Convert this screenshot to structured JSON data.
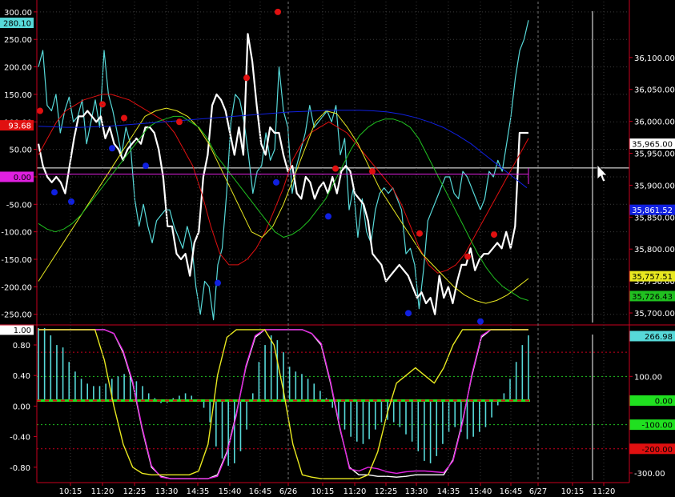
{
  "colors": {
    "background": "#000000",
    "axis": "#c8001e",
    "grid": "#3a3a3a",
    "tick_text": "#ffffff",
    "cyan": "#57d9d9",
    "white": "#ffffff",
    "red": "#e01010",
    "yellow": "#e8e820",
    "green": "#20c020",
    "blue": "#1020e0",
    "magenta": "#e020e0"
  },
  "chart_data": [
    {
      "type": "line",
      "title": "",
      "x_ticks": [
        "10:15",
        "11:20",
        "12:25",
        "13:30",
        "14:35",
        "15:40",
        "16:45",
        "6/26",
        "10:15",
        "11:20",
        "12:25",
        "13:30",
        "14:35",
        "15:40",
        "16:45",
        "6/27",
        "10:15",
        "11:20"
      ],
      "left_axis": {
        "ticks": [
          300,
          250,
          200,
          150,
          100,
          50,
          0,
          -50,
          -100,
          -150,
          -200,
          -250
        ],
        "ylim": [
          -265,
          310
        ]
      },
      "right_axis": {
        "ticks": [
          36100,
          36050,
          36000,
          35950,
          35900,
          35850,
          35800,
          35750,
          35700
        ],
        "ylim": [
          35685,
          36180
        ]
      },
      "value_labels": [
        {
          "text": "280.10",
          "bg": "#57d9d9",
          "fg": "#000000",
          "side": "left",
          "y_value": 280.1
        },
        {
          "text": "93.68",
          "bg": "#e01010",
          "fg": "#ffffff",
          "side": "left",
          "y_value": 93.68
        },
        {
          "text": "0.00",
          "bg": "#e020e0",
          "fg": "#000000",
          "side": "left",
          "y_value": 0
        },
        {
          "text": "35,965.00",
          "bg": "#ffffff",
          "fg": "#000000",
          "side": "right",
          "y_value": 35965
        },
        {
          "text": "35,861.52",
          "bg": "#1020e0",
          "fg": "#ffffff",
          "side": "right",
          "y_value": 35861.52
        },
        {
          "text": "35,757.51",
          "bg": "#e8e820",
          "fg": "#000000",
          "side": "right",
          "y_value": 35757.51
        },
        {
          "text": "35,726.43",
          "bg": "#20c020",
          "fg": "#000000",
          "side": "right",
          "y_value": 35726.43
        }
      ],
      "hline_value": 35927,
      "series": [
        {
          "color": "#57d9d9",
          "axis": "left",
          "y": [
            200,
            230,
            130,
            120,
            150,
            80,
            120,
            145,
            100,
            110,
            140,
            60,
            100,
            140,
            90,
            230,
            150,
            120,
            80,
            40,
            90,
            60,
            -40,
            -90,
            -50,
            -90,
            -120,
            -80,
            -70,
            -60,
            -60,
            -90,
            -110,
            -130,
            -90,
            -120,
            -200,
            -250,
            -190,
            -200,
            -260,
            -160,
            -130,
            -30,
            100,
            150,
            140,
            100,
            40,
            -30,
            10,
            20,
            80,
            30,
            50,
            200,
            120,
            90,
            -30,
            20,
            50,
            80,
            130,
            90,
            100,
            110,
            120,
            100,
            130,
            40,
            70,
            -60,
            -20,
            -110,
            -40,
            -100,
            -120,
            -60,
            -30,
            -20,
            -30,
            -20,
            -40,
            -60,
            -140,
            -130,
            -160,
            -240,
            -170,
            -80,
            -60,
            -40,
            -20,
            0,
            0,
            -30,
            -40,
            10,
            0,
            -20,
            -40,
            -60,
            -40,
            10,
            0,
            30,
            10,
            60,
            110,
            180,
            230,
            250,
            285
          ]
        },
        {
          "color": "#ffffff",
          "axis": "left",
          "y": [
            60,
            20,
            0,
            -10,
            0,
            -10,
            -30,
            20,
            70,
            110,
            110,
            120,
            110,
            100,
            110,
            70,
            90,
            60,
            50,
            30,
            50,
            60,
            70,
            60,
            90,
            90,
            80,
            50,
            0,
            -90,
            -90,
            -140,
            -150,
            -140,
            -180,
            -120,
            -100,
            0,
            40,
            130,
            150,
            140,
            120,
            80,
            40,
            90,
            40,
            260,
            210,
            130,
            60,
            40,
            90,
            80,
            80,
            40,
            10,
            20,
            -30,
            -40,
            0,
            -10,
            -40,
            -20,
            -10,
            -30,
            0,
            -30,
            10,
            20,
            10,
            -30,
            -40,
            -50,
            -80,
            -140,
            -150,
            -160,
            -190,
            -180,
            -170,
            -160,
            -170,
            -180,
            -200,
            -220,
            -210,
            -230,
            -220,
            -250,
            -180,
            -220,
            -200,
            -230,
            -190,
            -160,
            -160,
            -130,
            -170,
            -150,
            -140,
            -140,
            -130,
            -120,
            -130,
            -100,
            -130,
            -90,
            80,
            80,
            80
          ]
        },
        {
          "color": "#e01010",
          "axis": "left",
          "y": [
            40,
            70,
            100,
            120,
            130,
            140,
            145,
            150,
            150,
            145,
            140,
            130,
            120,
            110,
            100,
            80,
            50,
            20,
            -30,
            -90,
            -140,
            -160,
            -160,
            -150,
            -130,
            -100,
            -60,
            -20,
            30,
            60,
            80,
            90,
            100,
            90,
            80,
            60,
            40,
            20,
            0,
            -20,
            -50,
            -90,
            -130,
            -160,
            -175,
            -170,
            -160,
            -140,
            -110,
            -80,
            -50,
            -20,
            10,
            40,
            70
          ]
        },
        {
          "color": "#e8e820",
          "axis": "left",
          "y": [
            -190,
            -160,
            -130,
            -100,
            -70,
            -40,
            -10,
            20,
            50,
            80,
            110,
            120,
            125,
            120,
            110,
            90,
            60,
            20,
            -20,
            -60,
            -100,
            -110,
            -90,
            -50,
            0,
            50,
            100,
            120,
            115,
            90,
            60,
            20,
            -20,
            -50,
            -80,
            -110,
            -140,
            -160,
            -180,
            -200,
            -215,
            -225,
            -230,
            -225,
            -215,
            -200,
            -185
          ]
        },
        {
          "color": "#20c020",
          "axis": "left",
          "y": [
            -85,
            -95,
            -100,
            -95,
            -85,
            -70,
            -50,
            -30,
            -10,
            10,
            30,
            50,
            70,
            90,
            100,
            105,
            110,
            110,
            100,
            90,
            70,
            40,
            20,
            0,
            -20,
            -40,
            -60,
            -80,
            -100,
            -110,
            -105,
            -95,
            -80,
            -60,
            -40,
            -10,
            20,
            50,
            75,
            90,
            100,
            105,
            105,
            100,
            90,
            70,
            40,
            10,
            -20,
            -50,
            -80,
            -110,
            -140,
            -165,
            -185,
            -200,
            -210,
            -220,
            -225
          ]
        },
        {
          "color": "#1020e0",
          "axis": "left",
          "y": [
            92,
            91,
            90,
            90,
            91,
            92,
            94,
            96,
            98,
            100,
            102,
            104,
            106,
            108,
            110,
            112,
            114,
            116,
            118,
            119,
            120,
            121,
            121,
            121,
            120,
            118,
            114,
            108,
            100,
            90,
            76,
            60,
            40,
            20,
            0,
            -20
          ]
        },
        {
          "color": "#e020e0",
          "axis": "left",
          "y": [
            5,
            5
          ]
        }
      ],
      "dots_red": [
        [
          120,
          37
        ],
        [
          103,
          69
        ],
        [
          93,
          101
        ],
        [
          69,
          71
        ],
        [
          52,
          97
        ],
        [
          -16,
          168
        ]
      ],
      "dots_blue": [
        [
          -45,
          163
        ],
        [
          -50,
          60
        ],
        [
          -5,
          56
        ],
        [
          -34,
          41
        ],
        [
          -92,
          88
        ],
        [
          -70,
          161
        ],
        [
          -210,
          182
        ],
        [
          -290,
          216
        ],
        [
          -313,
          189
        ],
        [
          -19,
          87
        ]
      ]
    },
    {
      "type": "bar",
      "title": "",
      "left_axis": {
        "ticks": [
          0.8,
          0.4,
          0.0,
          -0.4,
          -0.8
        ],
        "ylim": [
          -0.97,
          1.02
        ],
        "top_label": "1.00"
      },
      "right_axis": {
        "ticks": [
          100,
          0,
          -100,
          -200,
          -300
        ],
        "ylim": [
          -330,
          300
        ]
      },
      "value_labels": [
        {
          "text": "266.98",
          "bg": "#57d9d9",
          "fg": "#000000",
          "side": "right",
          "y_value": 266.98
        },
        {
          "text": "0.00",
          "bg": "#20e020",
          "fg": "#000000",
          "side": "right",
          "y_value": 0
        },
        {
          "text": "-100.00",
          "bg": "#20e020",
          "fg": "#000000",
          "side": "right",
          "y_value": -100
        },
        {
          "text": "-200.00",
          "bg": "#e01010",
          "fg": "#000000",
          "side": "right",
          "y_value": -200
        }
      ],
      "hist_values": [
        300,
        300,
        270,
        230,
        220,
        160,
        120,
        90,
        70,
        60,
        60,
        70,
        90,
        100,
        110,
        100,
        80,
        60,
        30,
        10,
        -10,
        -10,
        10,
        20,
        30,
        20,
        0,
        -30,
        -90,
        -190,
        -240,
        -270,
        -260,
        -210,
        -120,
        30,
        160,
        230,
        270,
        250,
        200,
        140,
        120,
        110,
        90,
        70,
        40,
        10,
        -30,
        -80,
        -120,
        -150,
        -170,
        -180,
        -160,
        -120,
        -90,
        -80,
        -90,
        -110,
        -140,
        -170,
        -210,
        -250,
        -260,
        -230,
        -180,
        -130,
        -110,
        -130,
        -160,
        -150,
        -130,
        -110,
        -70,
        -20,
        30,
        90,
        160,
        230,
        270
      ],
      "ref_levels_left": [
        0.8,
        0.4,
        0.0,
        -0.4,
        -0.8
      ],
      "dotted_levels": [
        {
          "value": 200,
          "color": "#c8001e"
        },
        {
          "value": 100,
          "color": "#20c020"
        },
        {
          "value": -100,
          "color": "#20c020"
        },
        {
          "value": -200,
          "color": "#c8001e"
        }
      ],
      "series": [
        {
          "color": "#ffffff",
          "axis": "left",
          "y": [
            1,
            1,
            1,
            1,
            1,
            1,
            1,
            1,
            0.95,
            0.7,
            0.3,
            -0.3,
            -0.8,
            -0.92,
            -0.95,
            -0.95,
            -0.95,
            -0.95,
            -0.95,
            -0.9,
            -0.6,
            -0.1,
            0.5,
            0.9,
            1,
            1,
            1,
            1,
            1,
            0.95,
            0.8,
            0.3,
            -0.3,
            -0.8,
            -0.9,
            -0.9,
            -0.92,
            -0.92,
            -0.93,
            -0.92,
            -0.9,
            -0.9,
            -0.9,
            -0.9,
            -0.7,
            -0.2,
            0.4,
            0.9,
            1,
            1,
            1,
            1,
            1
          ]
        },
        {
          "color": "#e020e0",
          "axis": "left",
          "y": [
            1,
            1,
            1,
            1,
            1,
            1,
            1,
            1,
            0.95,
            0.72,
            0.32,
            -0.28,
            -0.78,
            -0.93,
            -0.95,
            -0.95,
            -0.95,
            -0.95,
            -0.95,
            -0.92,
            -0.62,
            -0.12,
            0.52,
            0.92,
            1,
            1,
            1,
            1,
            1,
            0.95,
            0.82,
            0.32,
            -0.28,
            -0.82,
            -0.85,
            -0.8,
            -0.82,
            -0.86,
            -0.88,
            -0.86,
            -0.85,
            -0.85,
            -0.86,
            -0.87,
            -0.72,
            -0.22,
            0.42,
            0.92,
            1,
            1,
            1,
            1,
            1
          ]
        },
        {
          "color": "#e8e820",
          "axis": "left",
          "y": [
            1,
            1,
            1,
            1,
            1,
            1,
            1,
            0.6,
            0.0,
            -0.5,
            -0.8,
            -0.88,
            -0.9,
            -0.9,
            -0.9,
            -0.9,
            -0.9,
            -0.85,
            -0.5,
            0.4,
            0.9,
            1,
            1,
            1,
            1,
            0.8,
            0.2,
            -0.5,
            -0.9,
            -0.93,
            -0.95,
            -0.95,
            -0.95,
            -0.95,
            -0.95,
            -0.9,
            -0.6,
            -0.1,
            0.3,
            0.4,
            0.5,
            0.4,
            0.3,
            0.5,
            0.8,
            1,
            1,
            1,
            1,
            1,
            1,
            1,
            1
          ]
        }
      ]
    }
  ]
}
